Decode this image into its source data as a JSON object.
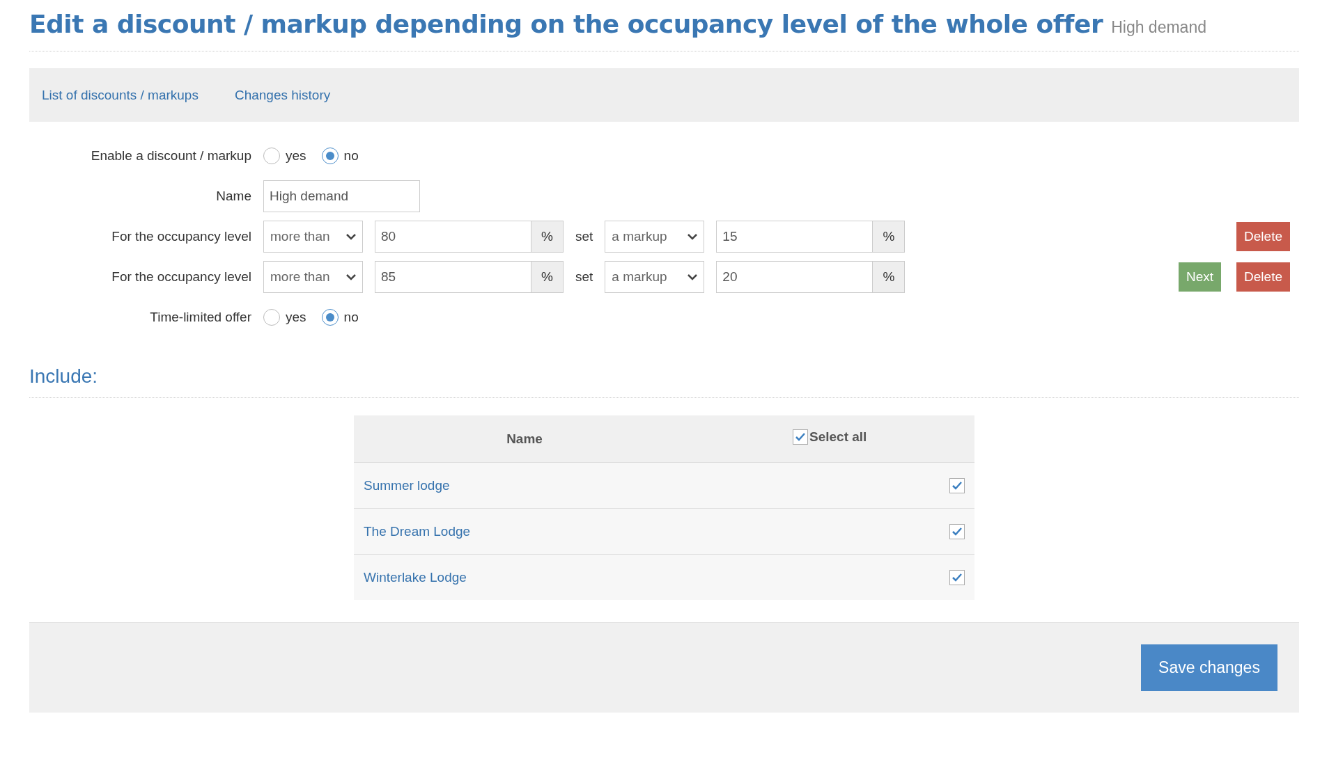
{
  "title": "Edit a discount / markup depending on the occupancy level of the whole offer",
  "subtitle": "High demand",
  "nav_links": [
    "List of discounts / markups",
    "Changes history"
  ],
  "enable": {
    "label": "Enable a discount / markup",
    "options": [
      {
        "label": "yes",
        "selected": false
      },
      {
        "label": "no",
        "selected": true
      }
    ]
  },
  "name_field": {
    "label": "Name",
    "value": "High demand"
  },
  "rules": [
    {
      "label": "For the occupancy level",
      "comparator": "more than",
      "threshold": "80",
      "threshold_unit": "%",
      "set_label": "set",
      "type": "a markup",
      "amount": "15",
      "amount_unit": "%",
      "buttons": [
        {
          "label": "Delete",
          "kind": "delete"
        }
      ]
    },
    {
      "label": "For the occupancy level",
      "comparator": "more than",
      "threshold": "85",
      "threshold_unit": "%",
      "set_label": "set",
      "type": "a markup",
      "amount": "20",
      "amount_unit": "%",
      "buttons": [
        {
          "label": "Next",
          "kind": "next"
        },
        {
          "label": "Delete",
          "kind": "delete"
        }
      ]
    }
  ],
  "time_limited": {
    "label": "Time-limited offer",
    "options": [
      {
        "label": "yes",
        "selected": false
      },
      {
        "label": "no",
        "selected": true
      }
    ]
  },
  "include": {
    "heading": "Include:",
    "table": {
      "name_column": "Name",
      "select_all": {
        "label": "Select all",
        "checked": true
      },
      "rows": [
        {
          "name": "Summer lodge",
          "checked": true
        },
        {
          "name": "The Dream Lodge",
          "checked": true
        },
        {
          "name": "Winterlake Lodge",
          "checked": true
        }
      ]
    }
  },
  "save_button": "Save changes"
}
